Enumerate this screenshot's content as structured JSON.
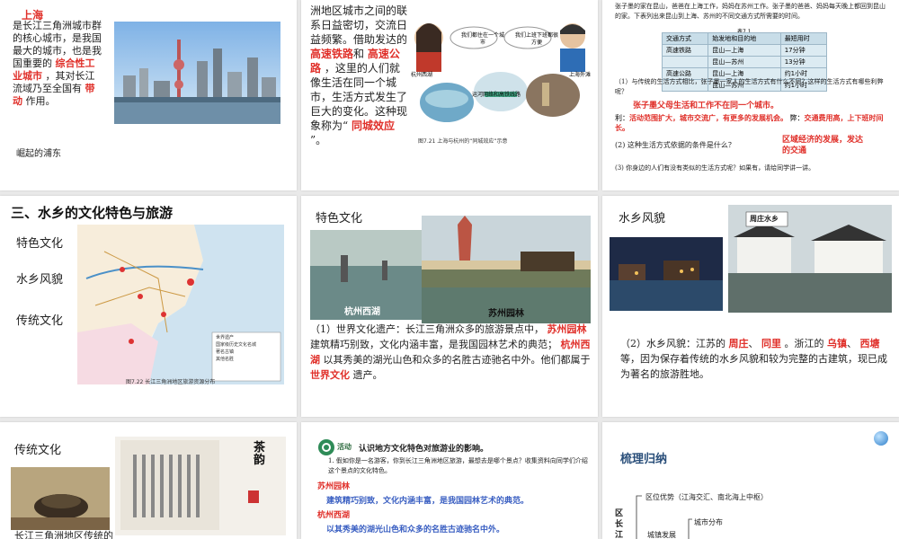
{
  "slide1": {
    "title_red": "上海",
    "text_a": "是长江三角洲城市群的核心城市，是我国最大的城市，也是我国重要的",
    "fill_1": "综合性工业城市",
    "text_b": "，其对长江流域乃至全国有",
    "fill_2": "带动",
    "text_c": "作用。",
    "caption": "崛起的浦东"
  },
  "slide2": {
    "text_a": "洲地区城市之间的联系日益密切，交流日益频繁。借助发达的",
    "fill_1": "高速铁路",
    "fill_and": "和",
    "fill_2": "高速公路",
    "text_b": "，这里的人们就像生活在同一个城市，生活方式发生了巨大的变化。这种现象称为“",
    "fill_3": "同城效应",
    "text_c": "”。",
    "bubble_left": "我们都住在一个城市",
    "bubble_right": "我们上班下班都很方便",
    "img_label_1": "杭州西湖",
    "img_label_2": "上海外滩",
    "img_label_3": "运河网络和高铁线路",
    "caption": "图7.21 上海与杭州的“同城效应”示意"
  },
  "slide3": {
    "intro": "张子墨的家在昆山，爸爸在上海工作，妈妈在苏州工作。张子墨的爸爸、妈妈每天晚上都回到昆山的家。下表列出来昆山到上海、苏州的不同交通方式所需要的时间。",
    "table_title": "表7.1",
    "table_headers": [
      "交通方式",
      "始发地和目的地",
      "最短用时"
    ],
    "table_rows": [
      [
        "高速铁路",
        "昆山—上海",
        "17分钟"
      ],
      [
        "",
        "昆山—苏州",
        "13分钟"
      ],
      [
        "高速公路",
        "昆山—上海",
        "约1小时"
      ],
      [
        "",
        "昆山—苏州",
        "约1小时"
      ]
    ],
    "q1": "（1）与传统的生活方式相比，张子墨一家人的生活方式有什么不同？这样的生活方式有哪些利弊呢？",
    "a1": "张子墨父母生活和工作不在同一个城市。",
    "a1b_label": "利：",
    "a1b": "活动范围扩大，城市交流广，有更多的发展机会。",
    "a1c_label": "弊：",
    "a1c": "交通费用高，上下班时间长。",
    "q2": "(2) 这种生活方式依据的条件是什么？",
    "a2": "区域经济的发展，发达的交通",
    "q3": "(3) 你身边的人们有没有类似的生活方式呢？如果有，请给同学讲一讲。"
  },
  "slide4": {
    "title": "三、水乡的文化特色与旅游",
    "item1": "特色文化",
    "item2": "水乡风貌",
    "item3": "传统文化",
    "legend_1": "世界遗产",
    "legend_2": "国家级历史文化名城",
    "legend_3": "著名古镇",
    "legend_4": "其他名胜",
    "map_caption": "图7.22 长江三角洲地区旅游资源分布"
  },
  "slide5": {
    "title": "特色文化",
    "label_1": "杭州西湖",
    "label_2": "苏州园林",
    "q": "（1）世界文化遗产：长江三角洲众多的旅游景点中，",
    "fill_1": "苏州园林",
    "text_b": "建筑精巧别致，文化内涵丰富，是我国园林艺术的典范；",
    "fill_2": "杭州西湖",
    "text_c": "以其秀美的湖光山色和众多的名胜古迹驰名中外。他们都属于",
    "fill_3": "世界文化",
    "text_d": "遗产。"
  },
  "slide6": {
    "title": "水乡风貌",
    "sign": "周庄水乡",
    "q": "（2）水乡风貌：江苏的",
    "fill_1": "周庄",
    "fill_2": "同里",
    "text_b": "。浙江的",
    "fill_3": "乌镇",
    "fill_4": "西塘",
    "text_c": "等，因为保存着传统的水乡风貌和较为完整的古建筑，现已成为著名的旅游胜地。"
  },
  "slide7": {
    "title": "传统文化",
    "text": "长江三角洲地区传统的",
    "calligraphy": "茶韵"
  },
  "slide8": {
    "activity_label": "活动",
    "activity_title": "认识地方文化特色对旅游业的影响。",
    "q1": "1. 假如你是一名游客，你到长江三角洲地区旅游，最想去是哪个景点？收集资料向同学们介绍这个景点的文化特色。",
    "h1": "苏州园林",
    "t1": "建筑精巧别致，文化内涵丰富，是我国园林艺术的典范。",
    "h2": "杭州西湖",
    "t2": "以其秀美的湖光山色和众多的名胜古迹驰名中外。"
  },
  "slide9": {
    "title": "梳理归纳",
    "root": "区长江三",
    "branch_1": "区位优势（江海交汇、南北海上中枢）",
    "branch_2": "城市分布",
    "branch_3": "城镇发展"
  }
}
